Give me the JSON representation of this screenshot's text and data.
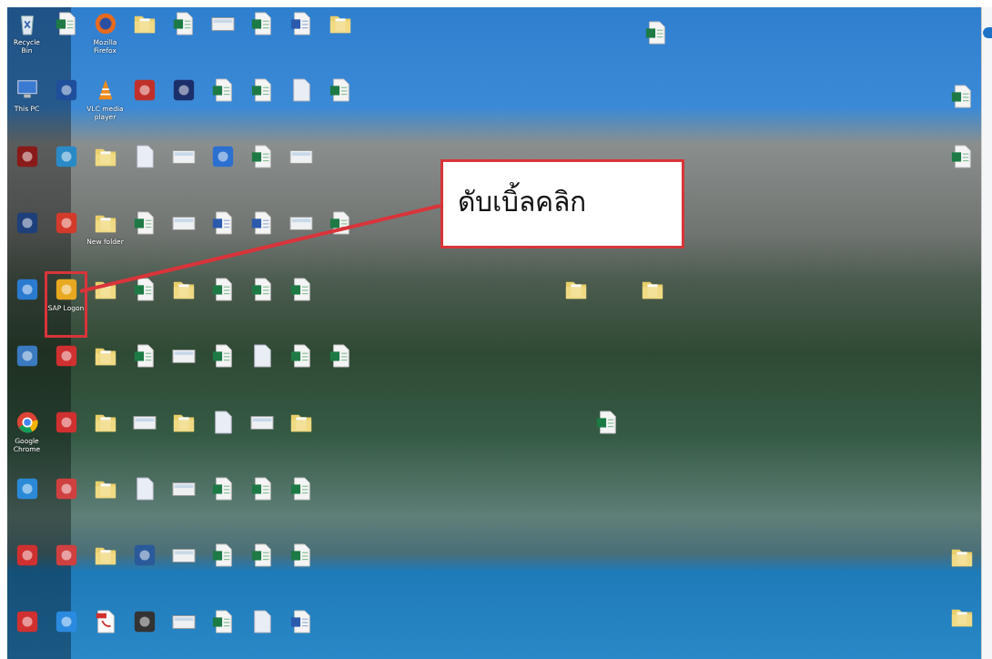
{
  "desktop": {
    "icon_rows": [
      [
        {
          "kind": "trash",
          "label": "Recycle Bin",
          "marked": false
        },
        {
          "kind": "excel",
          "marked": false
        },
        {
          "kind": "browser",
          "label": "Mozilla Firefox",
          "marked": false
        },
        {
          "kind": "folder",
          "marked": false
        },
        {
          "kind": "excel",
          "marked": false
        },
        {
          "kind": "image",
          "marked": false
        },
        {
          "kind": "excel",
          "marked": false
        },
        {
          "kind": "word",
          "marked": false
        },
        {
          "kind": "folder",
          "marked": false
        }
      ],
      [
        {
          "kind": "computer",
          "label": "This PC",
          "marked": false
        },
        {
          "kind": "app",
          "color": "#1f4f9a",
          "marked": false
        },
        {
          "kind": "cone",
          "label": "VLC media player",
          "marked": false
        },
        {
          "kind": "app",
          "color": "#c0302a",
          "marked": false
        },
        {
          "kind": "app",
          "color": "#1b2f6b",
          "marked": false
        },
        {
          "kind": "excel",
          "marked": false
        },
        {
          "kind": "excel",
          "marked": false
        },
        {
          "kind": "file",
          "marked": false
        },
        {
          "kind": "excel",
          "marked": false
        }
      ],
      [
        {
          "kind": "app",
          "color": "#8a1a1a",
          "marked": false
        },
        {
          "kind": "app",
          "color": "#2a8ac8",
          "marked": false
        },
        {
          "kind": "folder",
          "marked": false
        },
        {
          "kind": "file",
          "marked": false
        },
        {
          "kind": "image",
          "marked": false
        },
        {
          "kind": "app",
          "color": "#2b6fd0",
          "marked": false
        },
        {
          "kind": "excel",
          "marked": false
        },
        {
          "kind": "image",
          "marked": false
        }
      ],
      [
        {
          "kind": "app",
          "color": "#1e3f7a",
          "marked": false
        },
        {
          "kind": "app",
          "color": "#d33a2a",
          "marked": false
        },
        {
          "kind": "folder",
          "label": "New folder",
          "marked": false
        },
        {
          "kind": "excel",
          "marked": false
        },
        {
          "kind": "image",
          "marked": false
        },
        {
          "kind": "word",
          "marked": false
        },
        {
          "kind": "word",
          "marked": false
        },
        {
          "kind": "image",
          "marked": false
        },
        {
          "kind": "excel",
          "marked": false
        }
      ],
      [
        {
          "kind": "app",
          "color": "#2a7ad0",
          "marked": false
        },
        {
          "kind": "app",
          "color": "#e8a820",
          "label": "SAP Logon",
          "marked": true
        },
        {
          "kind": "folder",
          "marked": false
        },
        {
          "kind": "excel",
          "marked": false
        },
        {
          "kind": "folder",
          "marked": false
        },
        {
          "kind": "excel",
          "marked": false
        },
        {
          "kind": "excel",
          "marked": false
        },
        {
          "kind": "excel",
          "marked": false
        }
      ],
      [
        {
          "kind": "app",
          "color": "#3a7ac0",
          "marked": false
        },
        {
          "kind": "app",
          "color": "#d03030",
          "marked": false
        },
        {
          "kind": "folder",
          "marked": false
        },
        {
          "kind": "excel",
          "marked": false
        },
        {
          "kind": "image",
          "marked": false
        },
        {
          "kind": "excel",
          "marked": false
        },
        {
          "kind": "file",
          "marked": false
        },
        {
          "kind": "excel",
          "marked": false
        },
        {
          "kind": "excel",
          "marked": false
        }
      ],
      [
        {
          "kind": "chrome",
          "label": "Google Chrome",
          "marked": false
        },
        {
          "kind": "app",
          "color": "#d03030",
          "marked": false
        },
        {
          "kind": "folder",
          "marked": false
        },
        {
          "kind": "image",
          "marked": false
        },
        {
          "kind": "folder",
          "marked": false
        },
        {
          "kind": "file",
          "marked": false
        },
        {
          "kind": "image",
          "marked": false
        },
        {
          "kind": "folder",
          "marked": false
        }
      ],
      [
        {
          "kind": "app",
          "color": "#2a8ad8",
          "marked": false
        },
        {
          "kind": "app",
          "color": "#d04040",
          "marked": false
        },
        {
          "kind": "folder",
          "marked": false
        },
        {
          "kind": "file",
          "marked": false
        },
        {
          "kind": "image",
          "marked": false
        },
        {
          "kind": "excel",
          "marked": false
        },
        {
          "kind": "excel",
          "marked": false
        },
        {
          "kind": "excel",
          "marked": false
        }
      ],
      [
        {
          "kind": "app",
          "color": "#d03030",
          "marked": false
        },
        {
          "kind": "app",
          "color": "#d04040",
          "marked": false
        },
        {
          "kind": "folder",
          "marked": false
        },
        {
          "kind": "app",
          "color": "#2a5a9a",
          "marked": false
        },
        {
          "kind": "image",
          "marked": false
        },
        {
          "kind": "excel",
          "marked": false
        },
        {
          "kind": "excel",
          "marked": false
        },
        {
          "kind": "excel",
          "marked": false
        }
      ],
      [
        {
          "kind": "app",
          "color": "#d03030",
          "marked": false
        },
        {
          "kind": "app",
          "color": "#2a8ae0",
          "marked": false
        },
        {
          "kind": "pdf",
          "marked": false
        },
        {
          "kind": "app",
          "color": "#333333",
          "marked": false
        },
        {
          "kind": "image",
          "marked": false
        },
        {
          "kind": "excel",
          "marked": false
        },
        {
          "kind": "file",
          "marked": false
        },
        {
          "kind": "word",
          "marked": false
        }
      ]
    ],
    "loose_icons": [
      {
        "kind": "excel"
      },
      {
        "kind": "excel"
      },
      {
        "kind": "excel"
      },
      {
        "kind": "folder"
      },
      {
        "kind": "folder"
      },
      {
        "kind": "excel"
      },
      {
        "kind": "folder"
      },
      {
        "kind": "folder"
      }
    ]
  },
  "callout": {
    "text": "ดับเบิ้ลคลิก"
  }
}
